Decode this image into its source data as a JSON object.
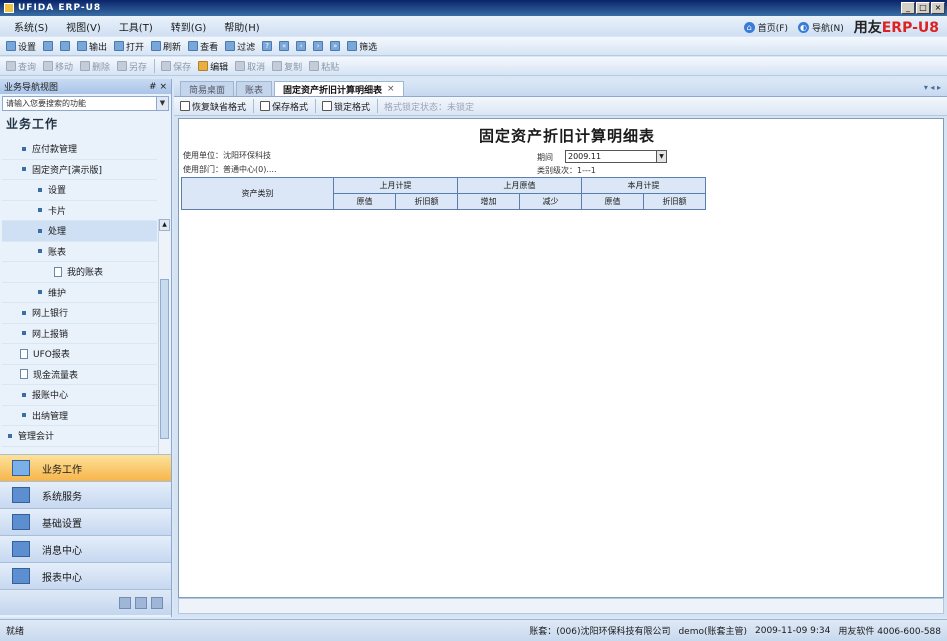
{
  "window": {
    "title": "UFIDA ERP-U8"
  },
  "menubar": [
    "系统(S)",
    "视图(V)",
    "工具(T)",
    "转到(G)",
    "帮助(H)"
  ],
  "topright": {
    "home": "首页(F)",
    "nav": "导航(N)",
    "brand_a": "用友",
    "brand_b": "ERP-U8"
  },
  "toolbar1": [
    "设置",
    "输出",
    "打开",
    "刷新",
    "查看",
    "过滤",
    "筛选"
  ],
  "toolbar2": [
    "查询",
    "移动",
    "删除",
    "另存",
    "保存",
    "编辑",
    "取消",
    "复制",
    "粘贴"
  ],
  "sidebar": {
    "title": "业务导航视图",
    "pin": "# ×",
    "search_placeholder": "请输入您要搜索的功能",
    "section": "业务工作",
    "tree": [
      "应付款管理",
      "固定资产[演示版]",
      "设置",
      "卡片",
      "处理",
      "账表",
      "我的账表",
      "维护",
      "网上银行",
      "网上报销",
      "UFO报表",
      "现金流量表",
      "报账中心",
      "出纳管理",
      "管理会计"
    ],
    "nav": [
      "业务工作",
      "系统服务",
      "基础设置",
      "消息中心",
      "报表中心"
    ]
  },
  "tabs": [
    "简易桌面",
    "账表",
    "固定资产折旧计算明细表"
  ],
  "tabs_nav": "▾ ◂ ▸",
  "report_toolbar": [
    "恢复缺省格式",
    "保存格式",
    "锁定格式",
    "格式锁定状态：未锁定"
  ],
  "report": {
    "title": "固定资产折旧计算明细表",
    "unit": "使用单位：沈阳环保科技",
    "dept": "使用部门：普通中心(0)....",
    "period_label": "期间",
    "period_value": "2009.11",
    "method": "类别级次：1---1",
    "headers": {
      "category": "资产类别",
      "g1": "上月计提",
      "g2": "上月原值",
      "g3": "本月计提",
      "sub": [
        "原值",
        "折旧额",
        "增加",
        "减少",
        "原值",
        "折旧额"
      ]
    }
  },
  "status": {
    "left": "就绪",
    "account": "账套：(006)沈阳环保科技有限公司",
    "user": "demo(账套主管)",
    "date": "2009-11-09 9:34",
    "phone": "用友软件 4006-600-588"
  }
}
